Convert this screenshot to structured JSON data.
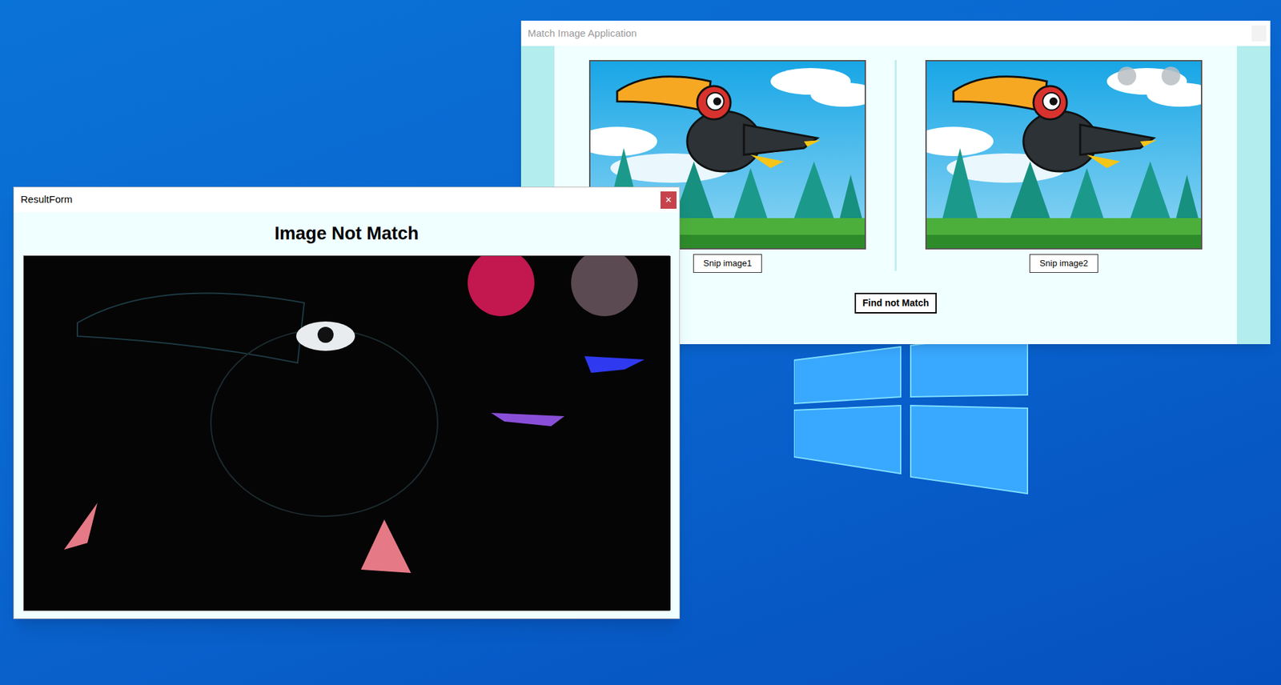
{
  "main_window": {
    "title": "Match Image Application",
    "panels": [
      {
        "button": "Snip image1",
        "markers": false
      },
      {
        "button": "Snip image2",
        "markers": true
      }
    ],
    "find_button": "Find not Match"
  },
  "result_window": {
    "title": "ResultForm",
    "close": "×",
    "heading": "Image Not Match"
  }
}
